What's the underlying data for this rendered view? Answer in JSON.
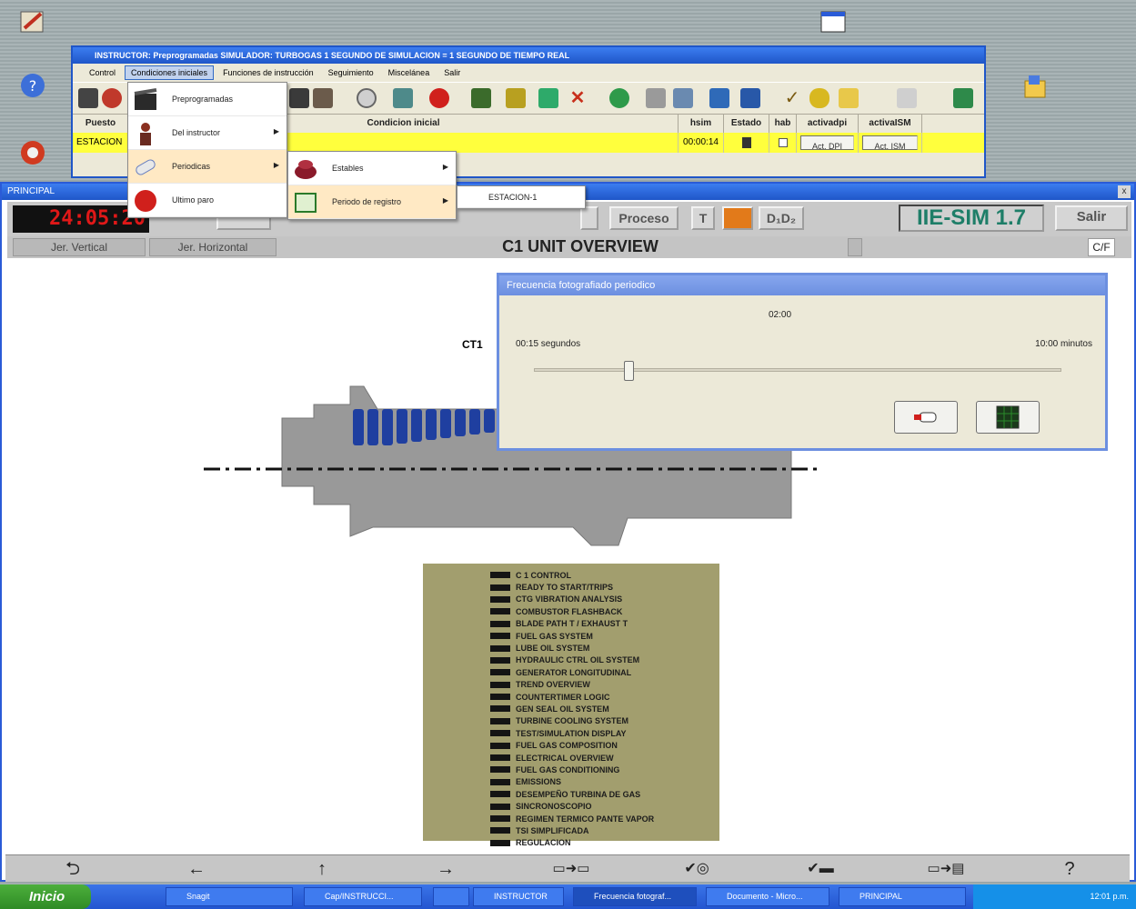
{
  "desktop": {
    "icons": [
      "app-icon",
      "help-icon",
      "network-icon",
      "window-icon",
      "folder-icon"
    ]
  },
  "instructor": {
    "title": "INSTRUCTOR: Preprogramadas          SIMULADOR: TURBOGAS          1 SEGUNDO DE SIMULACION = 1 SEGUNDO DE TIEMPO REAL",
    "menu": [
      "Control",
      "Condiciones iniciales",
      "Funciones de instrucción",
      "Seguimiento",
      "Miscelánea",
      "Salir"
    ],
    "grid_headers": [
      "Puesto",
      "Condicion inicial",
      "hsim",
      "Estado",
      "hab",
      "activadpi",
      "activaISM"
    ],
    "row": {
      "puesto": "ESTACION",
      "condicion": "",
      "hsim": "00:00:14",
      "act_dpi": "Act. DPI",
      "act_ism": "Act. ISM"
    }
  },
  "menus": {
    "level1": [
      "Preprogramadas",
      "Del instructor",
      "Periodicas",
      "Ultimo paro"
    ],
    "level2": [
      "Estables",
      "Periodo de registro"
    ],
    "level3": [
      "ESTACION-1"
    ]
  },
  "main": {
    "title": "PRINCIPAL",
    "close": "x",
    "clock": "24:05:20",
    "proceso_label": "Proceso",
    "t_label": "T",
    "d_label": "D₁D₂",
    "sim_badge": "IIE-SIM 1.7",
    "salir": "Salir",
    "nav_vertical": "Jer. Vertical",
    "nav_horizontal": "Jer. Horizontal",
    "page_title": "C1 UNIT OVERVIEW",
    "page_code": "C/F",
    "ct_label": "CT1"
  },
  "menu_panel_items": [
    "C 1 CONTROL",
    "READY TO START/TRIPS",
    "CTG VIBRATION ANALYSIS",
    "COMBUSTOR FLASHBACK",
    "BLADE PATH T / EXHAUST T",
    "FUEL GAS SYSTEM",
    "LUBE OIL SYSTEM",
    "HYDRAULIC CTRL OIL SYSTEM",
    "GENERATOR LONGITUDINAL",
    "TREND OVERVIEW",
    "COUNTERTIMER LOGIC",
    "GEN SEAL OIL SYSTEM",
    "TURBINE COOLING SYSTEM",
    "TEST/SIMULATION DISPLAY",
    "FUEL GAS COMPOSITION",
    "ELECTRICAL OVERVIEW",
    "FUEL GAS CONDITIONING",
    "EMISSIONS",
    "DESEMPEÑO TURBINA DE GAS",
    "SINCRONOSCOPIO",
    "REGIMEN TERMICO PANTE VAPOR",
    "TSI SIMPLIFICADA",
    "REGULACION"
  ],
  "dialog": {
    "title": "Frecuencia fotografiado periodico",
    "value": "02:00",
    "min_label": "00:15 segundos",
    "max_label": "10:00 minutos",
    "slider_level_fraction": 0.18
  },
  "bottom_nav": [
    "back-return-icon",
    "left-arrow-icon",
    "up-arrow-icon",
    "right-arrow-icon",
    "monitor-to-monitor-icon",
    "check-target-icon",
    "check-line-icon",
    "monitor-to-printer-icon",
    "help-icon"
  ],
  "bottom_nav_labels": {
    "help": "?"
  },
  "taskbar": {
    "start": "Inicio",
    "tasks": [
      "Snagit",
      "Cap/INSTRUCCI...",
      "",
      "INSTRUCTOR",
      "Frecuencia fotograf...",
      "Documento - Micro...",
      "PRINCIPAL"
    ],
    "clock": "12:01 p.m."
  },
  "colors": {
    "accent_blue": "#1f56c8",
    "highlight_yellow": "#ffff3d",
    "panel_olive": "#a29e6e",
    "turbine_gray": "#999999",
    "blade_blue": "#1f3fa0"
  }
}
